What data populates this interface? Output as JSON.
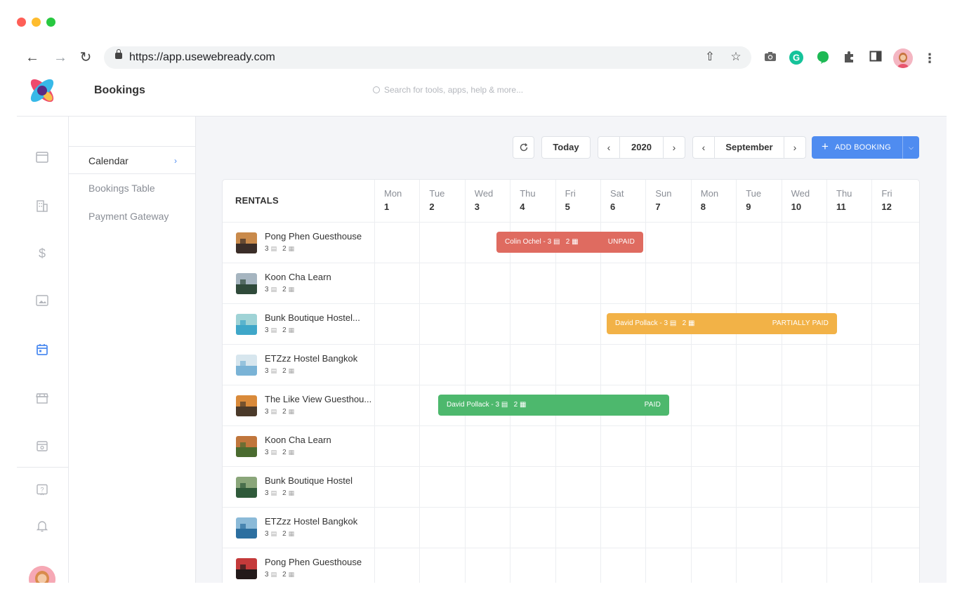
{
  "browser": {
    "url": "https://app.usewebready.com",
    "traffic_colors": [
      "#fe5f57",
      "#febc2e",
      "#28c840"
    ]
  },
  "app": {
    "page_title": "Bookings",
    "search_placeholder": "Search for tools, apps, help & more..."
  },
  "subnav": {
    "items": [
      {
        "label": "Calendar",
        "active": true
      },
      {
        "label": "Bookings Table",
        "active": false
      },
      {
        "label": "Payment Gateway",
        "active": false
      }
    ]
  },
  "controls": {
    "refresh_icon": "refresh-icon",
    "today_label": "Today",
    "year": "2020",
    "month": "September",
    "add_booking_label": "ADD BOOKING"
  },
  "calendar": {
    "rentals_header": "RENTALS",
    "days": [
      {
        "name": "Mon",
        "date": "1"
      },
      {
        "name": "Tue",
        "date": "2"
      },
      {
        "name": "Wed",
        "date": "3"
      },
      {
        "name": "Thu",
        "date": "4"
      },
      {
        "name": "Fri",
        "date": "5"
      },
      {
        "name": "Sat",
        "date": "6"
      },
      {
        "name": "Sun",
        "date": "7"
      },
      {
        "name": "Mon",
        "date": "8"
      },
      {
        "name": "Tue",
        "date": "9"
      },
      {
        "name": "Wed",
        "date": "10"
      },
      {
        "name": "Thu",
        "date": "11"
      },
      {
        "name": "Fri",
        "date": "12"
      }
    ],
    "rentals": [
      {
        "name": "Pong Phen Guesthouse",
        "beds": "3",
        "guests": "2"
      },
      {
        "name": "Koon Cha Learn",
        "beds": "3",
        "guests": "2"
      },
      {
        "name": "Bunk Boutique Hostel...",
        "beds": "3",
        "guests": "2"
      },
      {
        "name": "ETZzz Hostel Bangkok",
        "beds": "3",
        "guests": "2"
      },
      {
        "name": "The Like View Guesthou...",
        "beds": "3",
        "guests": "2"
      },
      {
        "name": "Koon Cha Learn",
        "beds": "3",
        "guests": "2"
      },
      {
        "name": "Bunk Boutique Hostel",
        "beds": "3",
        "guests": "2"
      },
      {
        "name": "ETZzz Hostel Bangkok",
        "beds": "3",
        "guests": "2"
      },
      {
        "name": "Pong Phen Guesthouse",
        "beds": "3",
        "guests": "2"
      }
    ],
    "bookings": [
      {
        "row": 0,
        "guest": "Colin Ochel",
        "beds": "3",
        "guests": "2",
        "status": "UNPAID",
        "color": "#df6b60"
      },
      {
        "row": 2,
        "guest": "David Pollack",
        "beds": "3",
        "guests": "2",
        "status": "PARTIALLY PAID",
        "color": "#f2b247"
      },
      {
        "row": 4,
        "guest": "David Pollack",
        "beds": "3",
        "guests": "2",
        "status": "PAID",
        "color": "#4db86d"
      }
    ]
  },
  "colors": {
    "accent": "#4f8cf0",
    "active_rail_icon": "#4f8cf0"
  }
}
